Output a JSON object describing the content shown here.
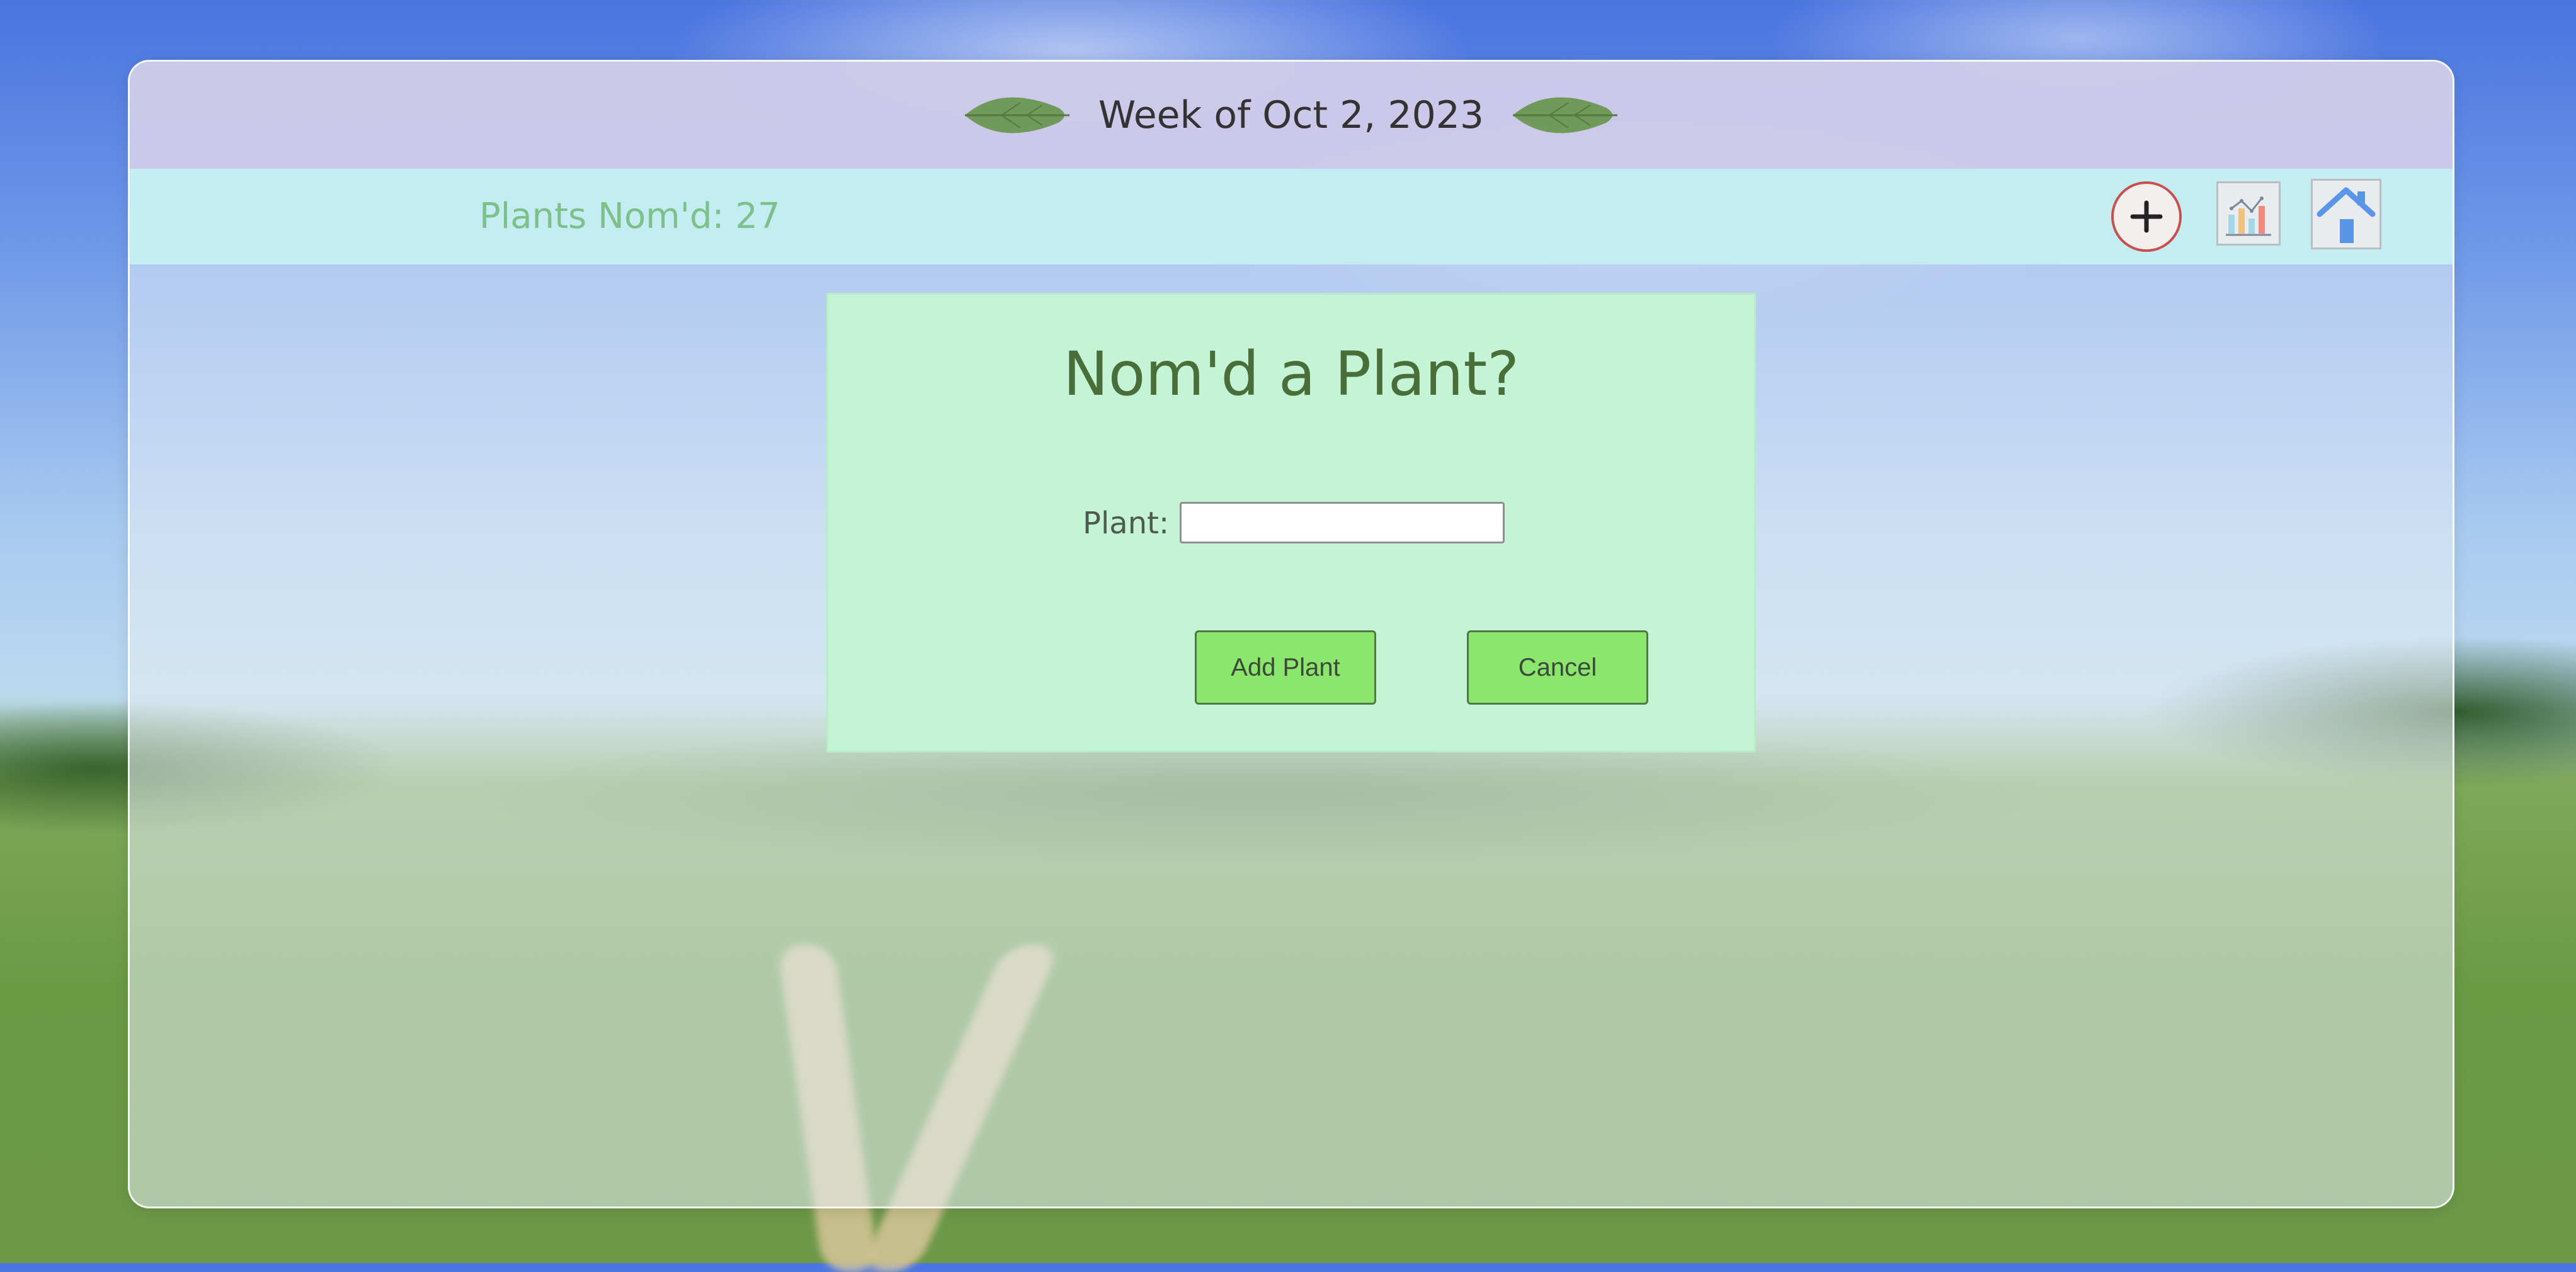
{
  "header": {
    "week_title": "Week of Oct 2, 2023",
    "left_icon": "leaf-icon",
    "right_icon": "leaf-icon"
  },
  "toolbar": {
    "count_label": "Plants Nom'd: 27",
    "add_button_icon": "plus-icon",
    "stats_button_icon": "bar-chart-icon",
    "home_button_icon": "home-icon"
  },
  "modal": {
    "title": "Nom'd a Plant?",
    "plant_label": "Plant:",
    "plant_value": "",
    "add_button_label": "Add Plant",
    "cancel_button_label": "Cancel"
  },
  "colors": {
    "header_bg": "#cec8e8",
    "toolbar_bg": "#c4eef2",
    "count_text": "#7ec08a",
    "modal_bg": "#c4f4d4",
    "modal_title": "#4a6e3a",
    "button_bg": "#8ce56c",
    "add_circle_border": "#c8504e"
  }
}
